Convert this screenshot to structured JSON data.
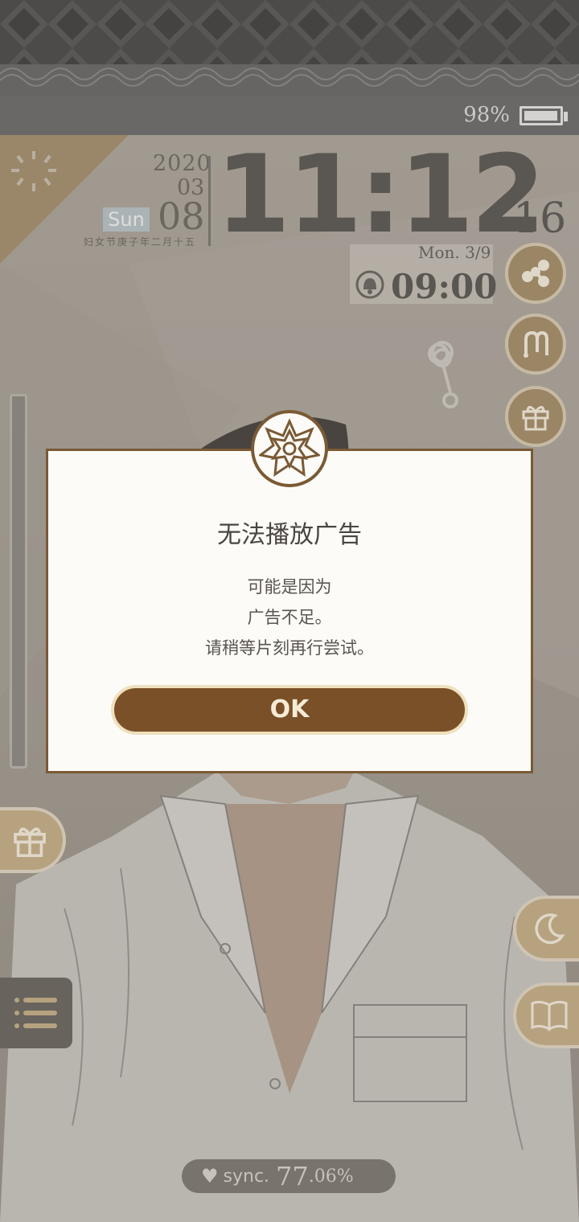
{
  "status_bar": {
    "battery_percent": "98%",
    "battery_level": 0.98
  },
  "clock": {
    "year": "2020",
    "month": "03",
    "day": "08",
    "weekday": "Sun",
    "lunar_text": "妇女节庚子年二月十五",
    "time": "11:12",
    "seconds": "16"
  },
  "alarm": {
    "date": "Mon.  3/9",
    "time": "09:00",
    "icon": "bell-icon"
  },
  "side_buttons": {
    "share": "share-icon",
    "m": "m-logo-icon",
    "gift_right": "gift-icon",
    "gift_left": "gift-icon",
    "moon": "moon-icon",
    "book": "book-icon",
    "menu": "menu-icon"
  },
  "sync": {
    "label": "sync.",
    "value_int": "77",
    "value_dec": ".06%",
    "icon": "heart-icon"
  },
  "dialog": {
    "title": "无法播放广告",
    "line1": "可能是因为",
    "line2": "广告不足。",
    "line3": "请稍等片刻再行尝试。",
    "ok_label": "OK",
    "emblem": "flower-emblem-icon"
  },
  "colors": {
    "accent_brown": "#7a5028",
    "dialog_border": "#7a5a35",
    "button_gold": "#a58f6b"
  }
}
